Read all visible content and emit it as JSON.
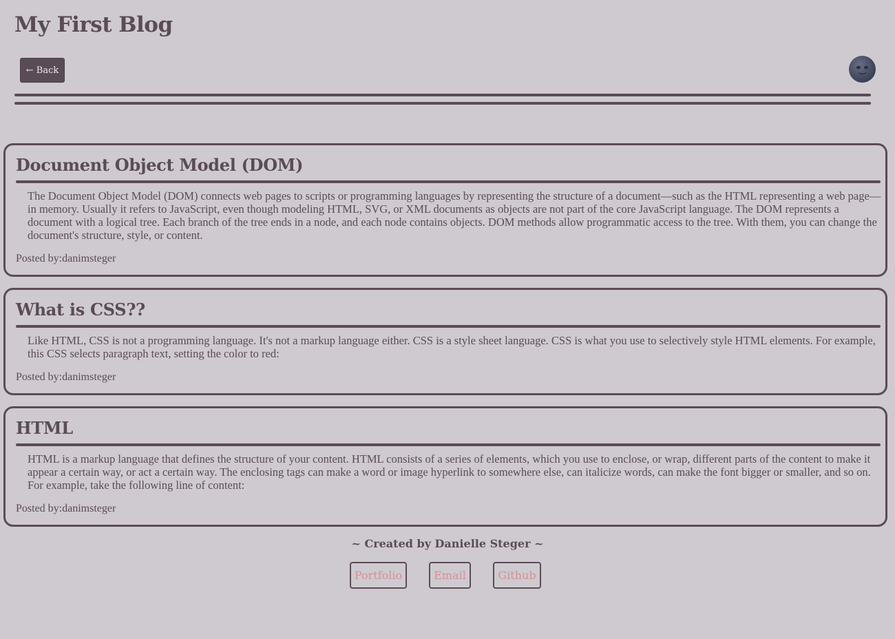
{
  "header": {
    "title": "My First Blog",
    "back_label": "← Back",
    "theme_toggle_icon": "new-moon-face-icon"
  },
  "posts": [
    {
      "title": "Document Object Model (DOM)",
      "body": "The Document Object Model (DOM) connects web pages to scripts or programming languages by representing the structure of a document—such as the HTML representing a web page—in memory. Usually it refers to JavaScript, even though modeling HTML, SVG, or XML documents as objects are not part of the core JavaScript language. The DOM represents a document with a logical tree. Each branch of the tree ends in a node, and each node contains objects. DOM methods allow programmatic access to the tree. With them, you can change the document's structure, style, or content.",
      "author": "Posted by:danimsteger"
    },
    {
      "title": "What is CSS??",
      "body": "Like HTML, CSS is not a programming language. It's not a markup language either. CSS is a style sheet language. CSS is what you use to selectively style HTML elements. For example, this CSS selects paragraph text, setting the color to red:",
      "author": "Posted by:danimsteger"
    },
    {
      "title": "HTML",
      "body": "HTML is a markup language that defines the structure of your content. HTML consists of a series of elements, which you use to enclose, or wrap, different parts of the content to make it appear a certain way, or act a certain way. The enclosing tags can make a word or image hyperlink to somewhere else, can italicize words, can make the font bigger or smaller, and so on. For example, take the following line of content:",
      "author": "Posted by:danimsteger"
    }
  ],
  "footer": {
    "credit": "~ Created by Danielle Steger ~",
    "links": [
      "Portfolio",
      "Email",
      "Github"
    ]
  },
  "colors": {
    "background": "#cfcacf",
    "primary": "#5a4c57",
    "link": "#d58f95"
  }
}
